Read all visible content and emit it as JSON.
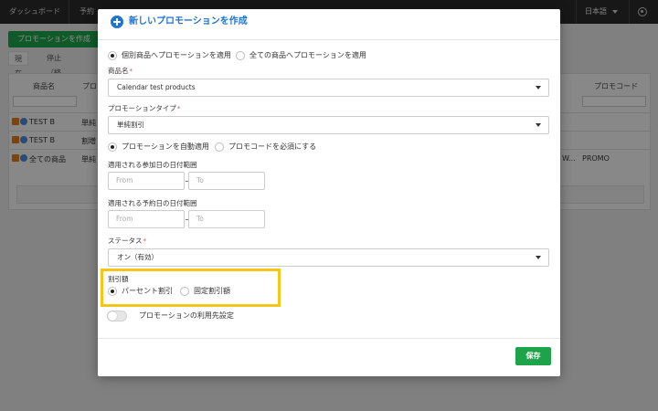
{
  "topnav": {
    "items": [
      "ダッシュボード",
      "予約"
    ],
    "language": "日本語"
  },
  "background": {
    "add_button": "プロモーションを作成",
    "tabs": [
      "現在",
      "停止（終了）"
    ],
    "columns": [
      "商品名",
      "プロ",
      "プロモコード"
    ],
    "rows": [
      {
        "product": "TEST B",
        "type": "単純",
        "code": ""
      },
      {
        "product": "TEST B",
        "type": "割増",
        "code": ""
      },
      {
        "product": "全ての商品",
        "type": "単純",
        "extra": "W...",
        "code": "PROMO"
      }
    ]
  },
  "modal": {
    "title": "新しいプロモーションを作成",
    "apply_scope": {
      "options": [
        "個別商品へプロモーションを適用",
        "全ての商品へプロモーションを適用"
      ],
      "selected": 0
    },
    "product_label": "商品名",
    "product_value": "Calendar test products",
    "promo_type_label": "プロモーションタイプ",
    "promo_type_value": "単純割引",
    "apply_mode": {
      "options": [
        "プロモーションを自動適用",
        "プロモコードを必須にする"
      ],
      "selected": 0
    },
    "participation_range_label": "適用される参加日の日付範囲",
    "reservation_range_label": "適用される予約日の日付範囲",
    "date_from_placeholder": "From",
    "date_to_placeholder": "To",
    "status_label": "ステータス",
    "status_value": "オン（有効）",
    "discount_label": "割引額",
    "discount_options": {
      "options": [
        "パーセント割引",
        "固定割引額"
      ],
      "selected": 0
    },
    "usage_toggle_label": "プロモーションの利用先設定",
    "save_label": "保存",
    "required_mark": "*"
  },
  "colors": {
    "accent": "#1f73d4",
    "save": "#1ea34a",
    "highlight": "#f5c519",
    "required": "#e0464a"
  }
}
